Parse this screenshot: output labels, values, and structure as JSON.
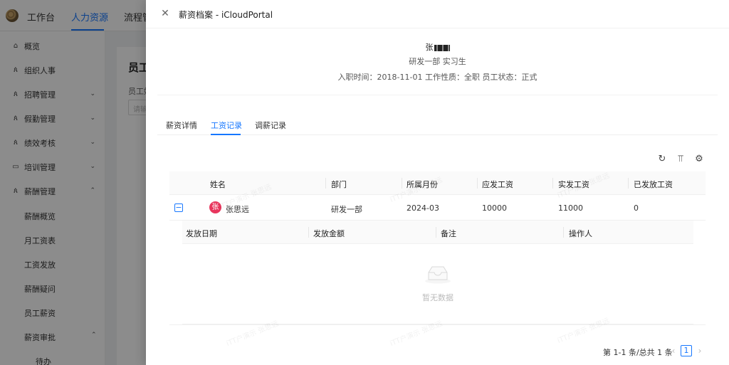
{
  "topbar": {
    "workbench": "工作台",
    "hr": "人力资源",
    "process": "流程管"
  },
  "sidebar": {
    "items": [
      {
        "label": "概览",
        "icon": "home-icon"
      },
      {
        "label": "组织人事",
        "icon": "people-icon"
      },
      {
        "label": "招聘管理",
        "icon": "people-icon"
      },
      {
        "label": "假勤管理",
        "icon": "people-icon"
      },
      {
        "label": "绩效考核",
        "icon": "people-icon"
      },
      {
        "label": "培训管理",
        "icon": "book-icon"
      },
      {
        "label": "薪酬管理",
        "icon": "people-icon"
      }
    ],
    "subitems": [
      "薪酬概览",
      "月工资表",
      "工资发放",
      "薪酬疑问",
      "员工薪资",
      "薪资审批",
      "待办"
    ]
  },
  "main": {
    "title": "员工",
    "label": "员工姓",
    "input_placeholder": "请输"
  },
  "drawer": {
    "title": "薪资档案 - iCloudPortal",
    "employee": {
      "name_prefix": "张",
      "dept_role": "研发一部   实习生",
      "meta": "入职时间：2018-11-01   工作性质：全职   员工状态：正式"
    },
    "tabs": [
      "薪资详情",
      "工资记录",
      "调薪记录"
    ],
    "table": {
      "columns": [
        "姓名",
        "部门",
        "所属月份",
        "应发工资",
        "实发工资",
        "已发放工资"
      ],
      "row": {
        "avatar": "张",
        "name": "张思远",
        "dept": "研发一部",
        "month": "2024-03",
        "payable": "10000",
        "actual": "11000",
        "paid": "0"
      },
      "subcolumns": [
        "发放日期",
        "发放金额",
        "备注",
        "操作人"
      ],
      "empty_text": "暂无数据"
    },
    "pagination": {
      "total": "第 1-1 条/总共 1 条",
      "current": "1"
    }
  },
  "watermark": "iTT户演示 张思远",
  "colors": {
    "primary": "#1677ff",
    "avatar": "#e8365d"
  }
}
